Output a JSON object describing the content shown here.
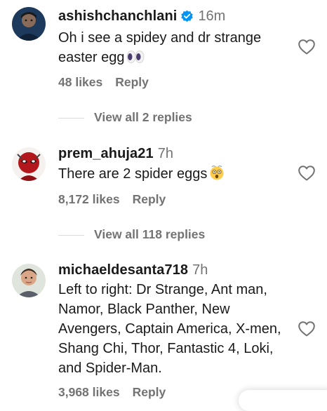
{
  "colors": {
    "text": "#1a1a1a",
    "muted": "#737373",
    "verified": "#0095f6"
  },
  "comments": [
    {
      "username": "ashishchanchlani",
      "verified": true,
      "time": "16m",
      "text": "Oh i see a spidey and dr strange easter egg",
      "emoji": "eyes-emoji",
      "likes": "48 likes",
      "reply": "Reply",
      "view_replies": "View all 2 replies"
    },
    {
      "username": "prem_ahuja21",
      "verified": false,
      "time": "7h",
      "text": "There are 2 spider eggs",
      "emoji": "astonished-emoji",
      "likes": "8,172 likes",
      "reply": "Reply",
      "view_replies": "View all 118 replies"
    },
    {
      "username": "michaeldesanta718",
      "verified": false,
      "time": "7h",
      "text": "Left to right: Dr Strange, Ant man, Namor, Black Panther, New Avengers, Captain America, X-men, Shang Chi, Thor, Fantastic 4, Loki, and Spider-Man.",
      "likes": "3,968 likes",
      "reply": "Reply"
    }
  ]
}
